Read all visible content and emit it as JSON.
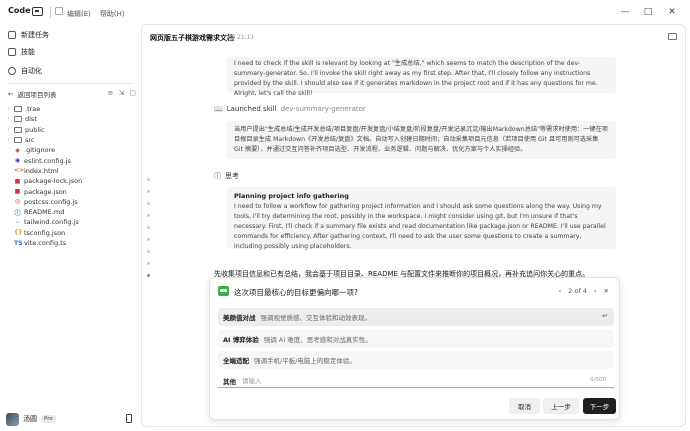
{
  "titlebar": {
    "app_label": "Code",
    "menus": [
      "编辑(E)",
      "帮助(H)"
    ],
    "controls": [
      "—",
      "□",
      "✕"
    ]
  },
  "sidebar": {
    "nav": [
      {
        "label": "新建任务",
        "icon": "new-task-icon"
      },
      {
        "label": "技能",
        "icon": "skills-icon"
      },
      {
        "label": "自动化",
        "icon": "automation-icon"
      }
    ],
    "back_label": "返回项目列表",
    "tree": [
      {
        "name": ".trae",
        "kind": "folder",
        "icon_text": "",
        "color": "#777777"
      },
      {
        "name": "dist",
        "kind": "folder",
        "icon_text": "",
        "color": "#777777"
      },
      {
        "name": "public",
        "kind": "folder",
        "icon_text": "",
        "color": "#777777"
      },
      {
        "name": "src",
        "kind": "folder",
        "icon_text": "",
        "color": "#777777"
      },
      {
        "name": ".gitignore",
        "kind": "file",
        "icon_text": "◆",
        "color": "#e05a2b"
      },
      {
        "name": "eslint.config.js",
        "kind": "file",
        "icon_text": "◉",
        "color": "#4b32c3"
      },
      {
        "name": "index.html",
        "kind": "file",
        "icon_text": "<>",
        "color": "#e0702b"
      },
      {
        "name": "package-lock.json",
        "kind": "file",
        "icon_text": "■",
        "color": "#cb3837"
      },
      {
        "name": "package.json",
        "kind": "file",
        "icon_text": "■",
        "color": "#cb3837"
      },
      {
        "name": "postcss.config.js",
        "kind": "file",
        "icon_text": "◎",
        "color": "#dd3a0a"
      },
      {
        "name": "README.md",
        "kind": "file",
        "icon_text": "ⓘ",
        "color": "#3a7bd5"
      },
      {
        "name": "tailwind.config.js",
        "kind": "file",
        "icon_text": "~",
        "color": "#38bdf8"
      },
      {
        "name": "tsconfig.json",
        "kind": "file",
        "icon_text": "{}",
        "color": "#c8a02a"
      },
      {
        "name": "vite.config.ts",
        "kind": "file",
        "icon_text": "TS",
        "color": "#3178c6"
      }
    ],
    "user": {
      "name": "汤圆",
      "badge": "Pro"
    }
  },
  "main": {
    "doc_title": "网页版五子棋游戏需求文档",
    "time": "21:11",
    "thinking_top": "I need to check if the skill is relevant by looking at \"生成总结,\" which seems to match the description of the dev-summary-generator. So, I'll invoke the skill right away as my first step. After that, I'll closely follow any instructions provided by the skill. I should also see if it generates markdown in the project root and if it has any questions for me. Alright, let's call the skill!",
    "launched_label": "Launched skill",
    "launched_name": "dev-summary-generator",
    "skill_desc": "当用户提出\"生成总结/生成开发总结/项目复盘/开发复盘/小结复盘/阶段复盘/开发记录沉淀/输出Markdown总结\"等需求时使用：一键在项目根目录生成 Markdown《开发总结/复盘》文档。自动写入创建日期时间；自动采集项目元信息（若项目使用 Git 且可用则可选采集 Git 摘要），并通过交互问答补齐项目选型、开发流程、业务逻辑、问题与解决、优化方案与个人实操经验。",
    "think_label": "思考",
    "think_title": "Planning project info gathering",
    "think_body": "I need to follow a workflow for gathering project information and I should ask some questions along the way. Using my tools, I'll try determining the root, possibly in the workspace. I might consider using git, but I'm unsure if that's necessary. First, I'll check if a summary file exists and read documentation like package.json or README. I'll use parallel commands for efficiency. After gathering context, I'll need to ask the user some questions to create a summary, including possibly using placeholders.",
    "bg_text": "先收集项目信息和已有总结，我会基于项目目录、README 与配置文件来推断你的项目概况，再补充追问你关心的重点。"
  },
  "dialog": {
    "question": "这次项目最核心的目标更偏向哪一项?",
    "pager": "2 of 4",
    "options": [
      {
        "title": "美颜值对战",
        "desc": "强调视觉质感、交互体验和动效表现。"
      },
      {
        "title": "AI 博弈体验",
        "desc": "强调 AI 难度、思考感和对战真实性。"
      },
      {
        "title": "全端适配",
        "desc": "强调手机/平板/电脑上的稳定体验。"
      }
    ],
    "other_label": "其他",
    "other_placeholder": "请输入",
    "counter": "0/500",
    "buttons": {
      "cancel": "取消",
      "prev": "上一步",
      "next": "下一步"
    }
  }
}
